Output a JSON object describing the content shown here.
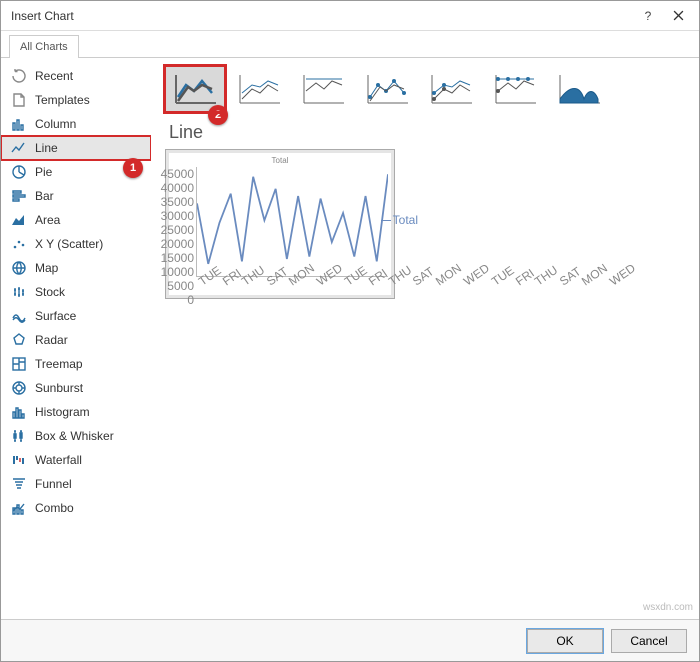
{
  "dialog": {
    "title": "Insert Chart"
  },
  "tabs": {
    "all": "All Charts"
  },
  "sidebar": {
    "items": [
      {
        "label": "Recent"
      },
      {
        "label": "Templates"
      },
      {
        "label": "Column"
      },
      {
        "label": "Line"
      },
      {
        "label": "Pie"
      },
      {
        "label": "Bar"
      },
      {
        "label": "Area"
      },
      {
        "label": "X Y (Scatter)"
      },
      {
        "label": "Map"
      },
      {
        "label": "Stock"
      },
      {
        "label": "Surface"
      },
      {
        "label": "Radar"
      },
      {
        "label": "Treemap"
      },
      {
        "label": "Sunburst"
      },
      {
        "label": "Histogram"
      },
      {
        "label": "Box & Whisker"
      },
      {
        "label": "Waterfall"
      },
      {
        "label": "Funnel"
      },
      {
        "label": "Combo"
      }
    ]
  },
  "callouts": {
    "one": "1",
    "two": "2"
  },
  "panel": {
    "title": "Line"
  },
  "footer": {
    "ok": "OK",
    "cancel": "Cancel"
  },
  "watermark": "wsxdn.com",
  "chart_data": {
    "type": "line",
    "title": "Total",
    "ylabel": "",
    "xlabel": "",
    "ylim": [
      0,
      45000
    ],
    "yticks": [
      0,
      5000,
      10000,
      15000,
      20000,
      25000,
      30000,
      35000,
      40000,
      45000
    ],
    "series": [
      {
        "name": "Total",
        "values": [
          30000,
          5000,
          22000,
          34000,
          6000,
          41000,
          23000,
          36000,
          7000,
          33000,
          8000,
          32000,
          14000,
          26000,
          8000,
          33000,
          6000,
          42000
        ]
      }
    ],
    "categories": [
      "TUE",
      "FRI",
      "THU",
      "SAT",
      "MON",
      "WED",
      "TUE",
      "FRI",
      "THU",
      "SAT",
      "MON",
      "WED",
      "TUE",
      "FRI",
      "THU",
      "SAT",
      "MON",
      "WED"
    ]
  }
}
